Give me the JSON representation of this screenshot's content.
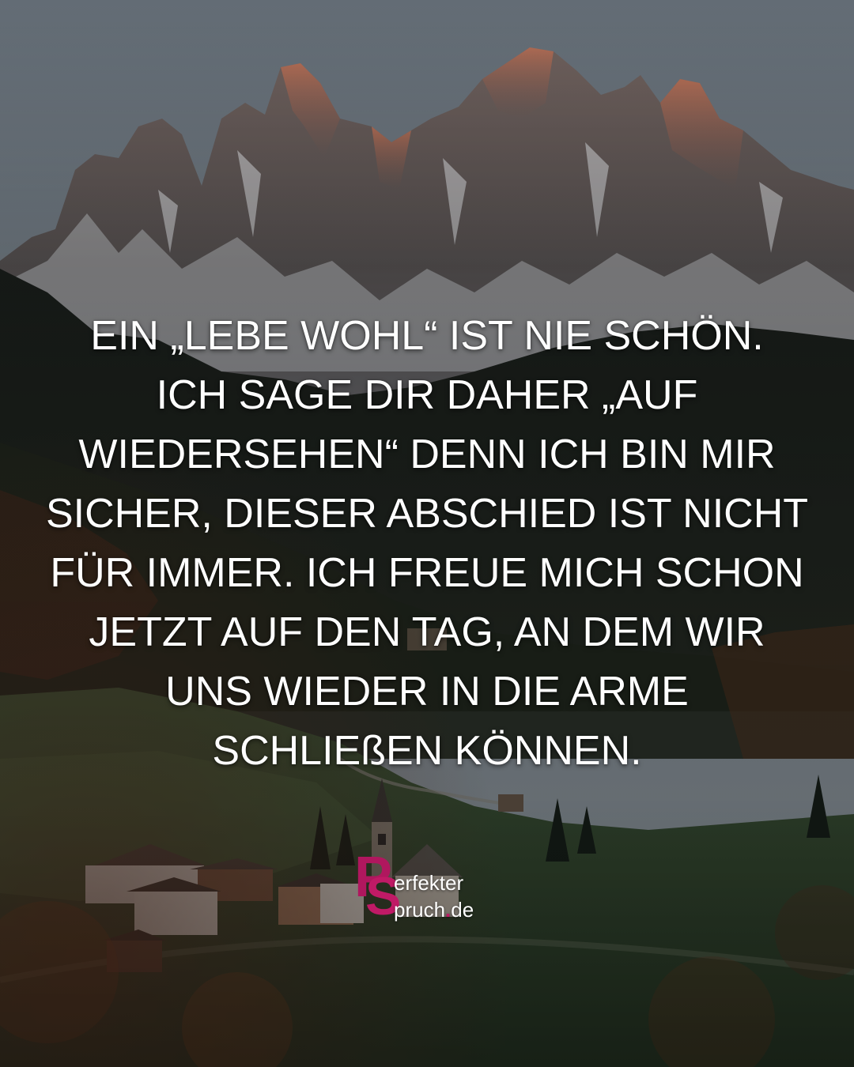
{
  "quote": {
    "lines": [
      "EIN „LEBE WOHL“ IST NIE SCHÖN.",
      "ICH SAGE DIR DAHER „AUF",
      "WIEDERSEHEN“ DENN ICH BIN MIR",
      "SICHER, DIESER ABSCHIED IST NICHT",
      "FÜR IMMER. ICH FREUE MICH SCHON",
      "JETZT AUF DEN TAG, AN DEM WIR",
      "UNS WIEDER IN DIE ARME",
      "SCHLIEßEN KÖNNEN."
    ]
  },
  "logo": {
    "letter_p": "P",
    "letter_s": "S",
    "word_1": "erfekter",
    "word_2": "pruch",
    "dot": ".",
    "domain": "de"
  },
  "colors": {
    "text": "#ffffff",
    "brand": "#c01a66",
    "sky": "#7d8891",
    "forest": "#1e2420",
    "meadow": "#3c5138"
  },
  "icons": [
    "mountain-photo",
    "church-icon",
    "house-icon"
  ]
}
